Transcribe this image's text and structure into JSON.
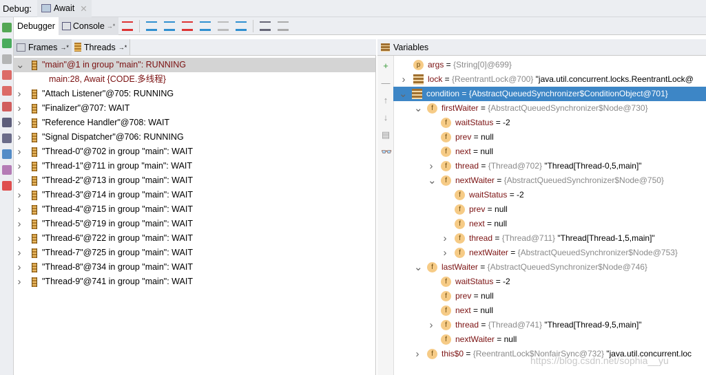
{
  "debug_label": "Debug:",
  "session_tab": "Await",
  "toolbar": {
    "debugger_tab": "Debugger",
    "console_tab": "Console",
    "pin": "→*",
    "icons": [
      "show-execution-point-icon",
      "step-over-icon",
      "step-into-icon",
      "force-step-into-icon",
      "step-out-icon",
      "drop-frame-icon",
      "run-to-cursor-icon",
      "evaluate-expression-icon",
      "trace-icon"
    ]
  },
  "left_toolbar_icons": [
    "rerun-icon",
    "resume-icon",
    "pause-icon",
    "stop-icon",
    "view-breakpoints-icon",
    "mute-breakpoints-icon",
    "camera-icon",
    "layout-icon",
    "settings-icon",
    "pin-icon",
    "close-icon"
  ],
  "frames_tab": "Frames",
  "threads_tab": "Threads",
  "pin": "→*",
  "threads": [
    {
      "label": "\"main\"@1 in group \"main\": RUNNING",
      "expanded": true,
      "current": true
    },
    {
      "label": "main:28, Await {CODE.多线程}",
      "frame": true
    },
    {
      "label": "\"Attach Listener\"@705: RUNNING"
    },
    {
      "label": "\"Finalizer\"@707: WAIT"
    },
    {
      "label": "\"Reference Handler\"@708: WAIT"
    },
    {
      "label": "\"Signal Dispatcher\"@706: RUNNING"
    },
    {
      "label": "\"Thread-0\"@702 in group \"main\": WAIT"
    },
    {
      "label": "\"Thread-1\"@711 in group \"main\": WAIT"
    },
    {
      "label": "\"Thread-2\"@713 in group \"main\": WAIT"
    },
    {
      "label": "\"Thread-3\"@714 in group \"main\": WAIT"
    },
    {
      "label": "\"Thread-4\"@715 in group \"main\": WAIT"
    },
    {
      "label": "\"Thread-5\"@719 in group \"main\": WAIT"
    },
    {
      "label": "\"Thread-6\"@722 in group \"main\": WAIT"
    },
    {
      "label": "\"Thread-7\"@725 in group \"main\": WAIT"
    },
    {
      "label": "\"Thread-8\"@734 in group \"main\": WAIT"
    },
    {
      "label": "\"Thread-9\"@741 in group \"main\": WAIT"
    }
  ],
  "variables_title": "Variables",
  "variables_toolbar_icons": [
    "new-watch-icon",
    "remove-watch-icon",
    "up-icon",
    "down-icon",
    "copy-icon",
    "show-watches-icon"
  ],
  "variables": [
    {
      "level": 0,
      "toggle": "",
      "icon": "p",
      "name": "args",
      "type": "{String[0]@699}",
      "value": ""
    },
    {
      "level": 0,
      "toggle": "collapsed",
      "icon": "bars",
      "name": "lock",
      "type": "{ReentrantLock@700}",
      "value": "\"java.util.concurrent.locks.ReentrantLock@"
    },
    {
      "level": 0,
      "toggle": "expanded",
      "icon": "bars",
      "name": "condition",
      "type": "{AbstractQueuedSynchronizer$ConditionObject@701}",
      "value": "",
      "selected": true
    },
    {
      "level": 1,
      "toggle": "expanded",
      "icon": "f",
      "name": "firstWaiter",
      "type": "{AbstractQueuedSynchronizer$Node@730}",
      "value": ""
    },
    {
      "level": 2,
      "toggle": "",
      "icon": "f",
      "name": "waitStatus",
      "type": "",
      "value": "-2"
    },
    {
      "level": 2,
      "toggle": "",
      "icon": "f",
      "name": "prev",
      "type": "",
      "value": "null"
    },
    {
      "level": 2,
      "toggle": "",
      "icon": "f",
      "name": "next",
      "type": "",
      "value": "null"
    },
    {
      "level": 2,
      "toggle": "collapsed",
      "icon": "f",
      "name": "thread",
      "type": "{Thread@702}",
      "value": "\"Thread[Thread-0,5,main]\""
    },
    {
      "level": 2,
      "toggle": "expanded",
      "icon": "f",
      "name": "nextWaiter",
      "type": "{AbstractQueuedSynchronizer$Node@750}",
      "value": ""
    },
    {
      "level": 3,
      "toggle": "",
      "icon": "f",
      "name": "waitStatus",
      "type": "",
      "value": "-2"
    },
    {
      "level": 3,
      "toggle": "",
      "icon": "f",
      "name": "prev",
      "type": "",
      "value": "null"
    },
    {
      "level": 3,
      "toggle": "",
      "icon": "f",
      "name": "next",
      "type": "",
      "value": "null"
    },
    {
      "level": 3,
      "toggle": "collapsed",
      "icon": "f",
      "name": "thread",
      "type": "{Thread@711}",
      "value": "\"Thread[Thread-1,5,main]\""
    },
    {
      "level": 3,
      "toggle": "collapsed",
      "icon": "f",
      "name": "nextWaiter",
      "type": "{AbstractQueuedSynchronizer$Node@753}",
      "value": ""
    },
    {
      "level": 1,
      "toggle": "expanded",
      "icon": "f",
      "name": "lastWaiter",
      "type": "{AbstractQueuedSynchronizer$Node@746}",
      "value": ""
    },
    {
      "level": 2,
      "toggle": "",
      "icon": "f",
      "name": "waitStatus",
      "type": "",
      "value": "-2"
    },
    {
      "level": 2,
      "toggle": "",
      "icon": "f",
      "name": "prev",
      "type": "",
      "value": "null"
    },
    {
      "level": 2,
      "toggle": "",
      "icon": "f",
      "name": "next",
      "type": "",
      "value": "null"
    },
    {
      "level": 2,
      "toggle": "collapsed",
      "icon": "f",
      "name": "thread",
      "type": "{Thread@741}",
      "value": "\"Thread[Thread-9,5,main]\""
    },
    {
      "level": 2,
      "toggle": "",
      "icon": "f",
      "name": "nextWaiter",
      "type": "",
      "value": "null"
    },
    {
      "level": 1,
      "toggle": "collapsed",
      "icon": "f",
      "name": "this$0",
      "type": "{ReentrantLock$NonfairSync@732}",
      "value": "\"java.util.concurrent.loc"
    }
  ],
  "watermark": "https://blog.csdn.net/sophia__yu",
  "colors": {
    "selection": "#3d86c6",
    "name": "#7a1010",
    "type": "#8a8a8a",
    "field_icon": "#f6cb86"
  }
}
